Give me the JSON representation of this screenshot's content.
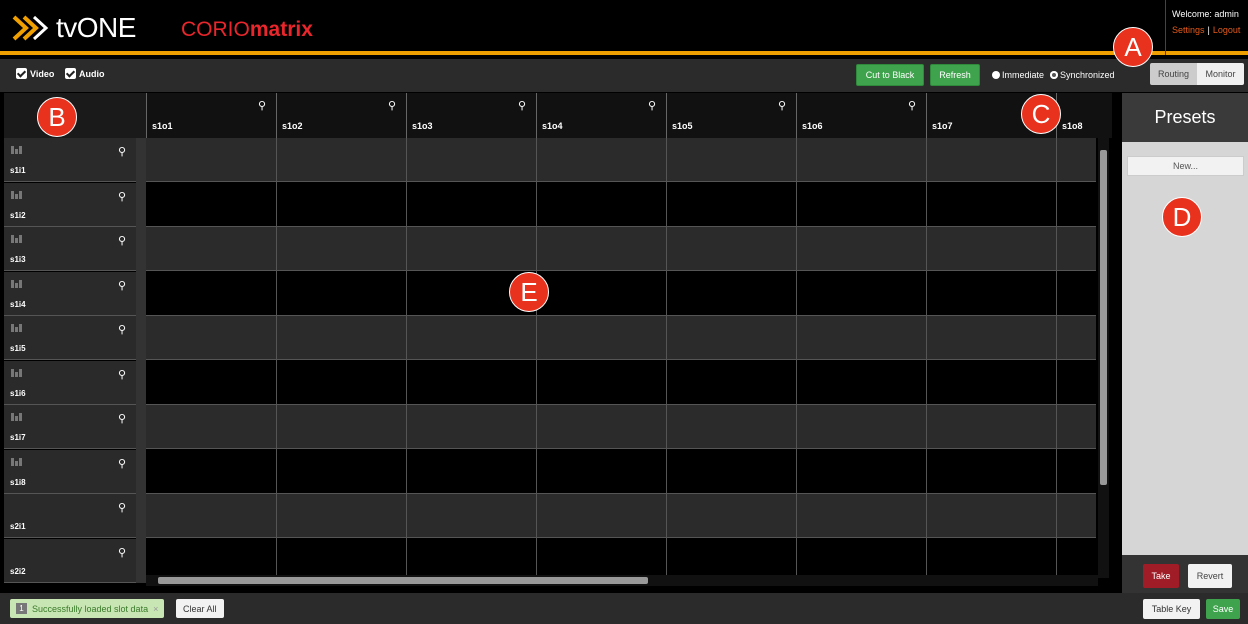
{
  "header": {
    "brand": "tvONE",
    "product_prefix": "CORIO",
    "product_suffix": "matrix",
    "welcome": "Welcome: admin",
    "settings_link": "Settings",
    "separator": "|",
    "logout_link": "Logout"
  },
  "toolbar": {
    "video_label": "Video",
    "audio_label": "Audio",
    "cut_to_black": "Cut to Black",
    "refresh": "Refresh",
    "immediate": "Immediate",
    "synchronized": "Synchronized",
    "routing": "Routing",
    "monitor": "Monitor"
  },
  "grid": {
    "outputs": [
      "s1o1",
      "s1o2",
      "s1o3",
      "s1o4",
      "s1o5",
      "s1o6",
      "s1o7",
      "s1o8"
    ],
    "inputs": [
      "s1i1",
      "s1i2",
      "s1i3",
      "s1i4",
      "s1i5",
      "s1i6",
      "s1i7",
      "s1i8",
      "s2i1",
      "s2i2"
    ]
  },
  "presets": {
    "title": "Presets",
    "new_label": "New...",
    "take": "Take",
    "revert": "Revert"
  },
  "footer": {
    "toast_count": "1",
    "toast_text": "Successfully loaded slot data",
    "toast_close": "×",
    "clear_all": "Clear All",
    "table_key": "Table Key",
    "save": "Save"
  },
  "callouts": {
    "a": "A",
    "b": "B",
    "c": "C",
    "d": "D",
    "e": "E"
  },
  "colors": {
    "accent_orange": "#f0a000",
    "brand_red": "#e8262b",
    "green": "#3fa34d",
    "take_red": "#a01c26"
  }
}
